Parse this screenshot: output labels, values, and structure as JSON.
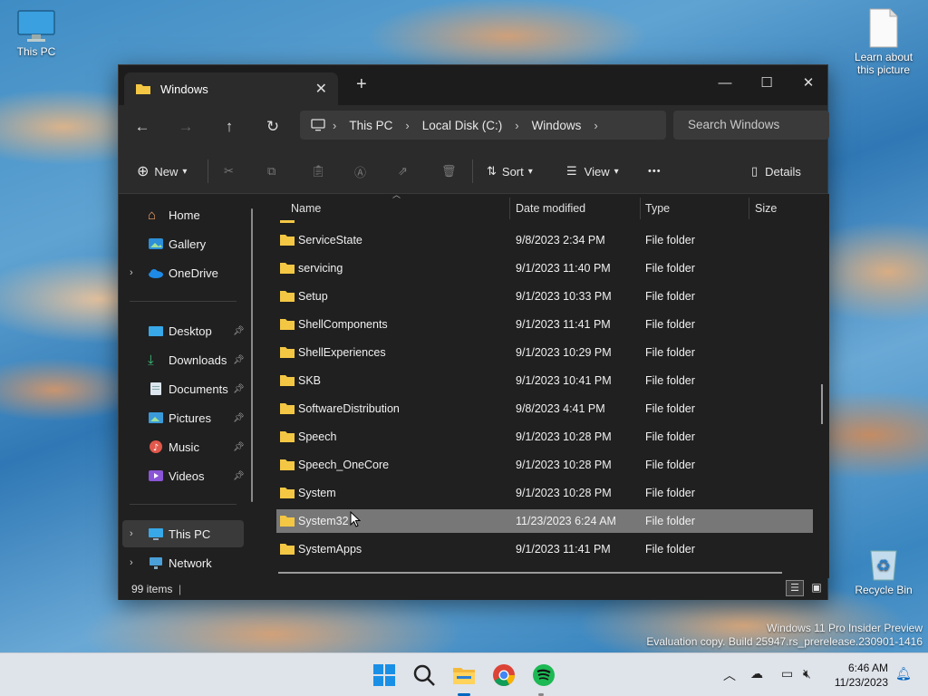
{
  "desktop": {
    "this_pc_label": "This PC",
    "learn_label_line1": "Learn about",
    "learn_label_line2": "this picture",
    "recycle_label": "Recycle Bin",
    "watermark_line1": "Windows 11 Pro Insider Preview",
    "watermark_line2": "Evaluation copy. Build 25947.rs_prerelease.230901-1416"
  },
  "window": {
    "tab_title": "Windows",
    "new_tab": "+",
    "address": {
      "root": "This PC",
      "drive": "Local Disk (C:)",
      "folder": "Windows"
    },
    "search_placeholder": "Search Windows",
    "commands": {
      "new": "New",
      "sort": "Sort",
      "view": "View",
      "more": "•••",
      "details": "Details"
    }
  },
  "sidebar": {
    "home": "Home",
    "gallery": "Gallery",
    "onedrive": "OneDrive",
    "desktop": "Desktop",
    "downloads": "Downloads",
    "documents": "Documents",
    "pictures": "Pictures",
    "music": "Music",
    "videos": "Videos",
    "this_pc": "This PC",
    "network": "Network"
  },
  "columns": {
    "name": "Name",
    "date": "Date modified",
    "type": "Type",
    "size": "Size"
  },
  "files": [
    {
      "name": "ServiceState",
      "date": "9/8/2023 2:34 PM",
      "type": "File folder"
    },
    {
      "name": "servicing",
      "date": "9/1/2023 11:40 PM",
      "type": "File folder"
    },
    {
      "name": "Setup",
      "date": "9/1/2023 10:33 PM",
      "type": "File folder"
    },
    {
      "name": "ShellComponents",
      "date": "9/1/2023 11:41 PM",
      "type": "File folder"
    },
    {
      "name": "ShellExperiences",
      "date": "9/1/2023 10:29 PM",
      "type": "File folder"
    },
    {
      "name": "SKB",
      "date": "9/1/2023 10:41 PM",
      "type": "File folder"
    },
    {
      "name": "SoftwareDistribution",
      "date": "9/8/2023 4:41 PM",
      "type": "File folder"
    },
    {
      "name": "Speech",
      "date": "9/1/2023 10:28 PM",
      "type": "File folder"
    },
    {
      "name": "Speech_OneCore",
      "date": "9/1/2023 10:28 PM",
      "type": "File folder"
    },
    {
      "name": "System",
      "date": "9/1/2023 10:28 PM",
      "type": "File folder"
    },
    {
      "name": "System32",
      "date": "11/23/2023 6:24 AM",
      "type": "File folder"
    },
    {
      "name": "SystemApps",
      "date": "9/1/2023 11:41 PM",
      "type": "File folder"
    }
  ],
  "status": {
    "items": "99 items"
  },
  "taskbar": {
    "time": "6:46 AM",
    "date": "11/23/2023"
  },
  "colors": {
    "accent": "#0067c0",
    "folder": "#f3c744",
    "window_bg": "#202020",
    "selected_row": "#777777"
  }
}
